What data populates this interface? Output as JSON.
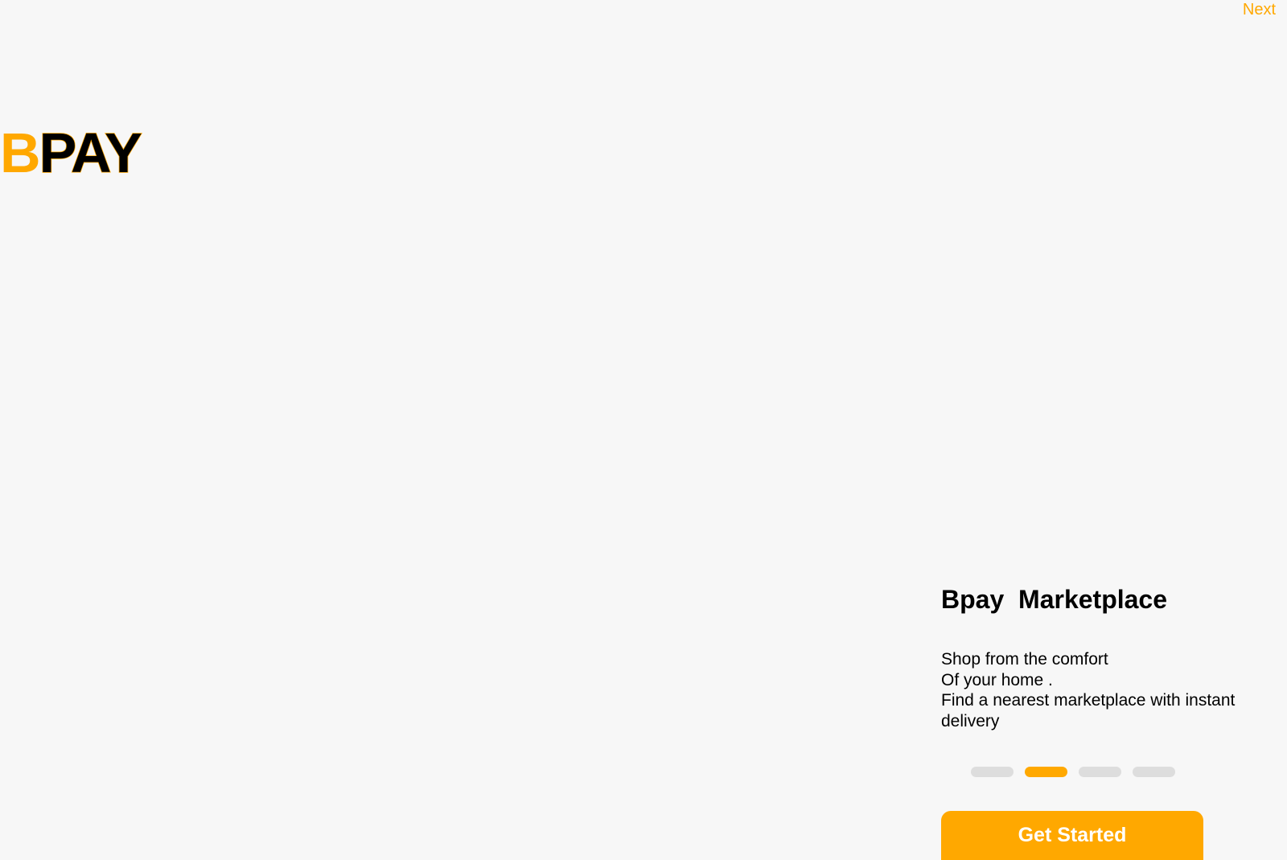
{
  "header": {
    "next_label": "Next"
  },
  "logo": {
    "first_letter": "B",
    "rest": "PAY"
  },
  "onboarding": {
    "title": "Bpay  Marketplace",
    "description_lines": [
      "Shop from the comfort",
      "Of your home .",
      "Find a nearest marketplace with instant",
      "delivery"
    ],
    "pager": {
      "total": 4,
      "active_index": 1
    },
    "cta_label": "Get Started"
  },
  "colors": {
    "accent": "#ffa800",
    "background": "#f7f7f7",
    "text": "#000000",
    "inactive_dot": "#dddddd"
  }
}
